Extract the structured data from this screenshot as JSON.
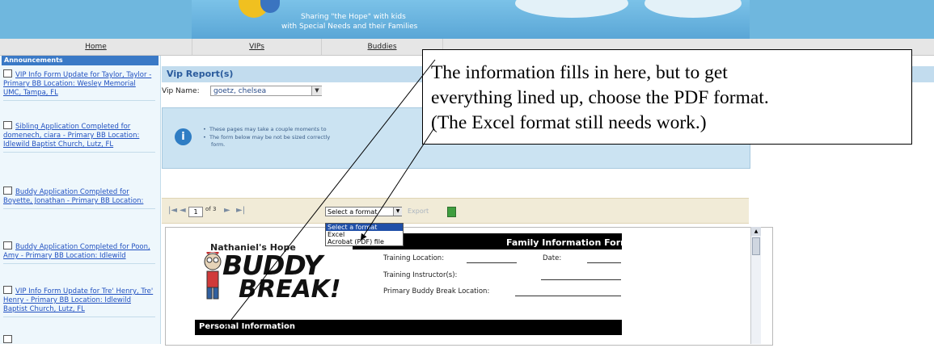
{
  "banner": {
    "line1": "Sharing \"the Hope\" with kids",
    "line2": "with Special Needs and their Families"
  },
  "nav": [
    {
      "label": "Home"
    },
    {
      "label": "VIPs"
    },
    {
      "label": "Buddies"
    }
  ],
  "announcements": {
    "header": "Announcements",
    "items": [
      {
        "text": "VIP Info Form Update for Taylor, Taylor - Primary BB Location: Wesley Memorial UMC, Tampa, FL"
      },
      {
        "text": "Sibling Application Completed for domenech, ciara - Primary BB Location: Idlewild Baptist Church, Lutz, FL"
      },
      {
        "text": "Buddy Application Completed for Boyette, Jonathan - Primary BB Location:"
      },
      {
        "text": "Buddy Application Completed for Poon, Amy - Primary BB Location: Idlewild"
      },
      {
        "text": "VIP Info Form Update for Tre' Henry, Tre' Henry - Primary BB Location: Idlewild Baptist Church, Lutz, FL"
      }
    ]
  },
  "report": {
    "title": "Vip Report(s)",
    "vip_label": "Vip Name:",
    "vip_value": "goetz, chelsea",
    "info": [
      "These pages may take a couple moments to",
      "The form below may be not be sized correctly",
      "form."
    ]
  },
  "toolbar": {
    "page": "1",
    "of_pages": "of 3",
    "format_selected": "Select a format",
    "export_label": "Export",
    "format_options": [
      "Select a format",
      "Excel",
      "Acrobat (PDF) file"
    ]
  },
  "form": {
    "org_name": "Nathaniel's Hope",
    "logo_line1": "BUDDY",
    "logo_line2": "BREAK!",
    "title": "Family Information Form",
    "training_location": "Training Location:",
    "date": "Date:",
    "training_instructors": "Training Instructor(s):",
    "primary_location": "Primary Buddy Break Location:",
    "personal_information": "Personal Information"
  },
  "callout": {
    "lines": [
      "The information fills in here, but to get",
      "everything lined up, choose the PDF format.",
      "(The Excel format still needs work.)"
    ]
  },
  "colors": {
    "banner": "#6fb7de",
    "title_bar": "#c2dcee",
    "announce_header": "#3a79c6",
    "link": "#2050c0",
    "toolbar": "#f1ebd7",
    "info_box": "#cbe3f2"
  }
}
